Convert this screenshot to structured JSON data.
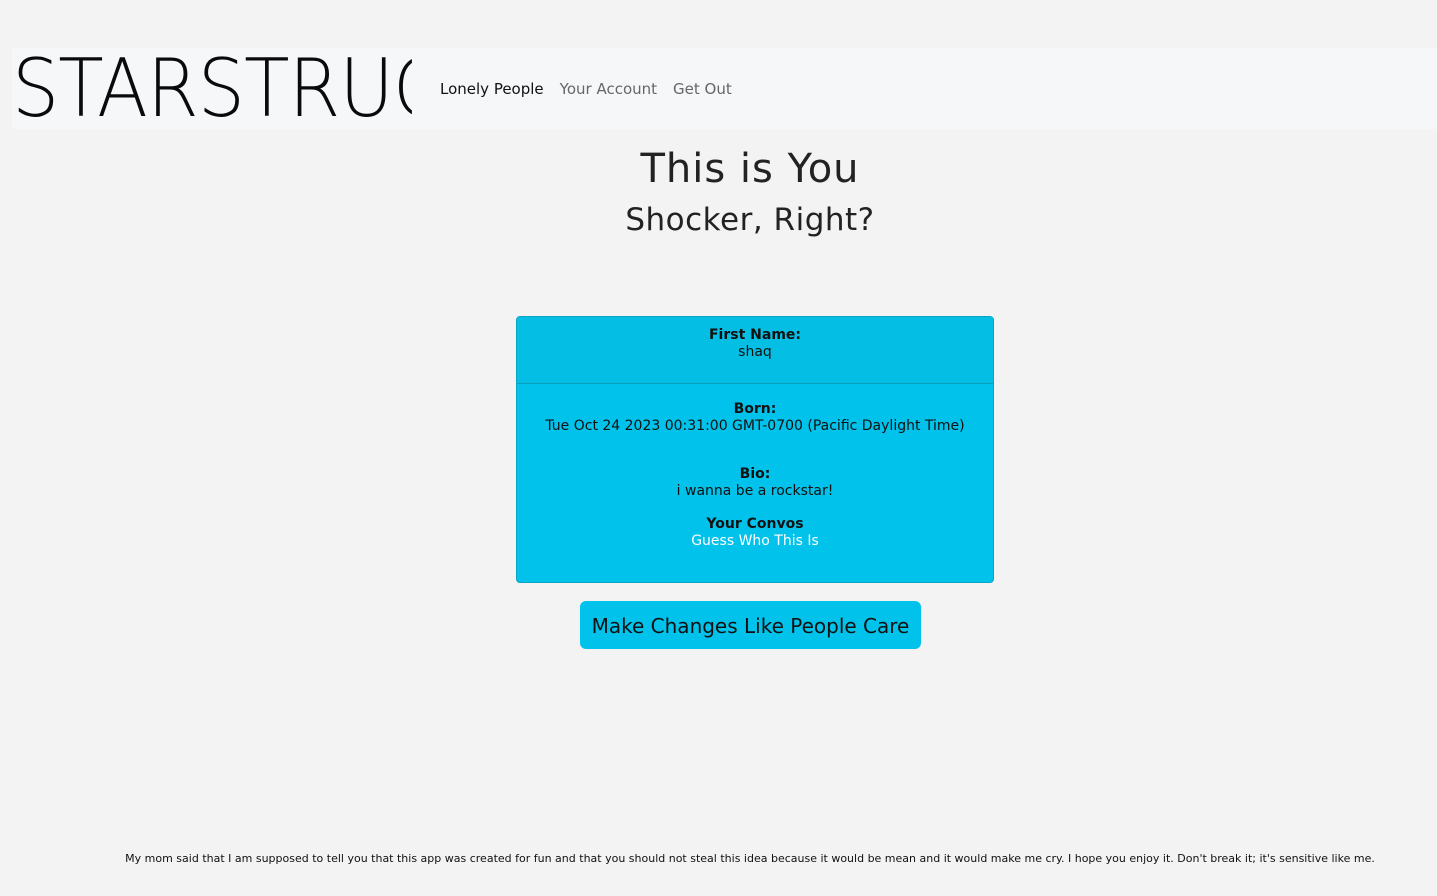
{
  "navbar": {
    "brand": "STARSTRUC",
    "links": [
      {
        "label": "Lonely People",
        "active": true
      },
      {
        "label": "Your Account",
        "active": false
      },
      {
        "label": "Get Out",
        "active": false
      }
    ]
  },
  "page": {
    "title": "This is You",
    "subtitle": "Shocker, Right?"
  },
  "profile": {
    "first_name_label": "First Name:",
    "first_name": "shaq",
    "born_label": "Born:",
    "born": "Tue Oct 24 2023 00:31:00 GMT-0700 (Pacific Daylight Time)",
    "bio_label": "Bio:",
    "bio": "i wanna be a rockstar!",
    "convos_label": "Your Convos",
    "convos": [
      "Guess Who This Is"
    ]
  },
  "actions": {
    "edit_button": "Make Changes Like People Care"
  },
  "footer": {
    "text": "My mom said that I am supposed to tell you that this app was created for fun and that you should not steal this idea because it would be mean and it would make me cry. I hope you enjoy it. Don't break it; it's sensitive like me."
  },
  "colors": {
    "background": "#f3f3f3",
    "navbar": "#f6f7f9",
    "card": "#00c2ea",
    "card_header": "#05bee4",
    "button": "#00c2ea",
    "link_white": "#ffffff"
  }
}
